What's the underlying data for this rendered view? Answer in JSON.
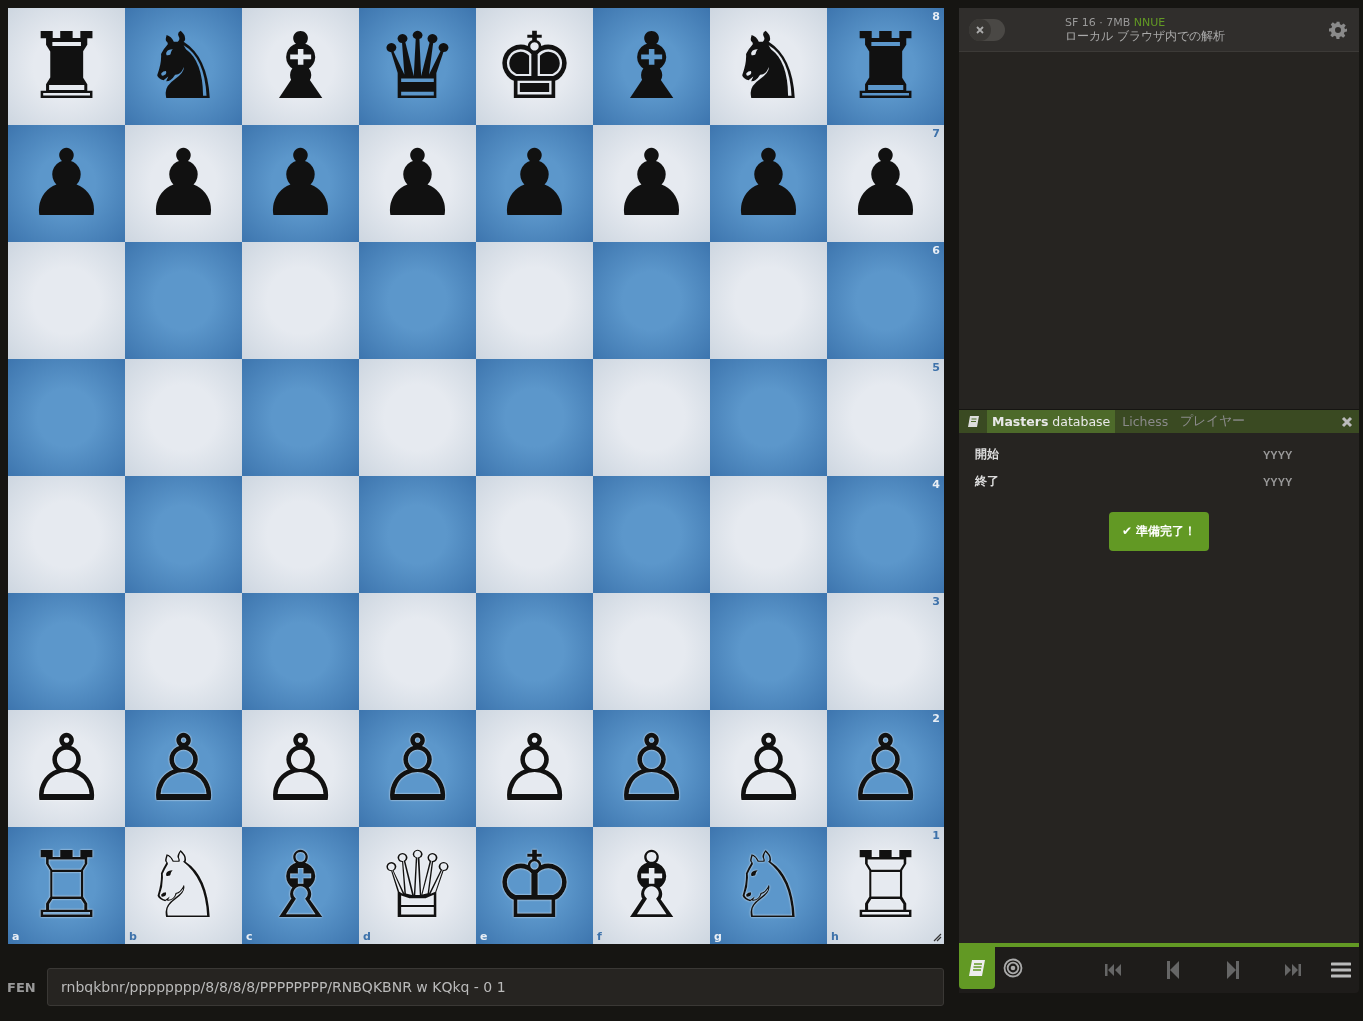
{
  "board": {
    "ranks": [
      {
        "label": "8",
        "pieces": [
          {
            "piece": "♜",
            "kind": "black"
          },
          {
            "piece": "♞",
            "kind": "black"
          },
          {
            "piece": "♝",
            "kind": "black"
          },
          {
            "piece": "♛",
            "kind": "black"
          },
          {
            "piece": "♚",
            "kind": "black"
          },
          {
            "piece": "♝",
            "kind": "black"
          },
          {
            "piece": "♞",
            "kind": "black"
          },
          {
            "piece": "♜",
            "kind": "black"
          }
        ]
      },
      {
        "label": "7",
        "pieces": [
          {
            "piece": "♟",
            "kind": "black"
          },
          {
            "piece": "♟",
            "kind": "black"
          },
          {
            "piece": "♟",
            "kind": "black"
          },
          {
            "piece": "♟",
            "kind": "black"
          },
          {
            "piece": "♟",
            "kind": "black"
          },
          {
            "piece": "♟",
            "kind": "black"
          },
          {
            "piece": "♟",
            "kind": "black"
          },
          {
            "piece": "♟",
            "kind": "black"
          }
        ]
      },
      {
        "label": "6"
      },
      {
        "label": "5"
      },
      {
        "label": "4"
      },
      {
        "label": "3"
      },
      {
        "label": "2",
        "pieces": [
          {
            "piece": "♙",
            "kind": "white"
          },
          {
            "piece": "♙",
            "kind": "white"
          },
          {
            "piece": "♙",
            "kind": "white"
          },
          {
            "piece": "♙",
            "kind": "white"
          },
          {
            "piece": "♙",
            "kind": "white"
          },
          {
            "piece": "♙",
            "kind": "white"
          },
          {
            "piece": "♙",
            "kind": "white"
          },
          {
            "piece": "♙",
            "kind": "white"
          }
        ]
      },
      {
        "label": "1",
        "pieces": [
          {
            "piece": "♖",
            "kind": "white"
          },
          {
            "piece": "♘",
            "kind": "white"
          },
          {
            "piece": "♗",
            "kind": "white"
          },
          {
            "piece": "♕",
            "kind": "white"
          },
          {
            "piece": "♔",
            "kind": "white"
          },
          {
            "piece": "♗",
            "kind": "white"
          },
          {
            "piece": "♘",
            "kind": "white"
          },
          {
            "piece": "♖",
            "kind": "white"
          }
        ]
      }
    ],
    "files": [
      "a",
      "b",
      "c",
      "d",
      "e",
      "f",
      "g",
      "h"
    ]
  },
  "fen": {
    "label": "FEN",
    "value": "rnbqkbnr/pppppppp/8/8/8/8/PPPPPPPP/RNBQKBNR w KQkq - 0 1"
  },
  "ceval": {
    "on": false,
    "engine": "SF 16 · 7MB",
    "engine_tag": "NNUE",
    "subtitle": "ローカル ブラウザ内での解析"
  },
  "explorer": {
    "tabs": [
      {
        "label": "**Masters** database",
        "selected": true
      },
      {
        "label": "Lichess",
        "selected": false
      },
      {
        "label": "プレイヤー",
        "selected": false
      }
    ],
    "fields": [
      {
        "label": "開始",
        "placeholder": "YYYY"
      },
      {
        "label": "終了",
        "placeholder": "YYYY"
      }
    ],
    "button": "✔ 準備完了！"
  },
  "controls": {
    "tools": [
      {
        "kind": "book",
        "selected": true
      },
      {
        "kind": "target",
        "selected": false
      }
    ],
    "nav": [
      {
        "kind": "first"
      },
      {
        "kind": "prev"
      },
      {
        "kind": "next"
      },
      {
        "kind": "last"
      }
    ]
  }
}
